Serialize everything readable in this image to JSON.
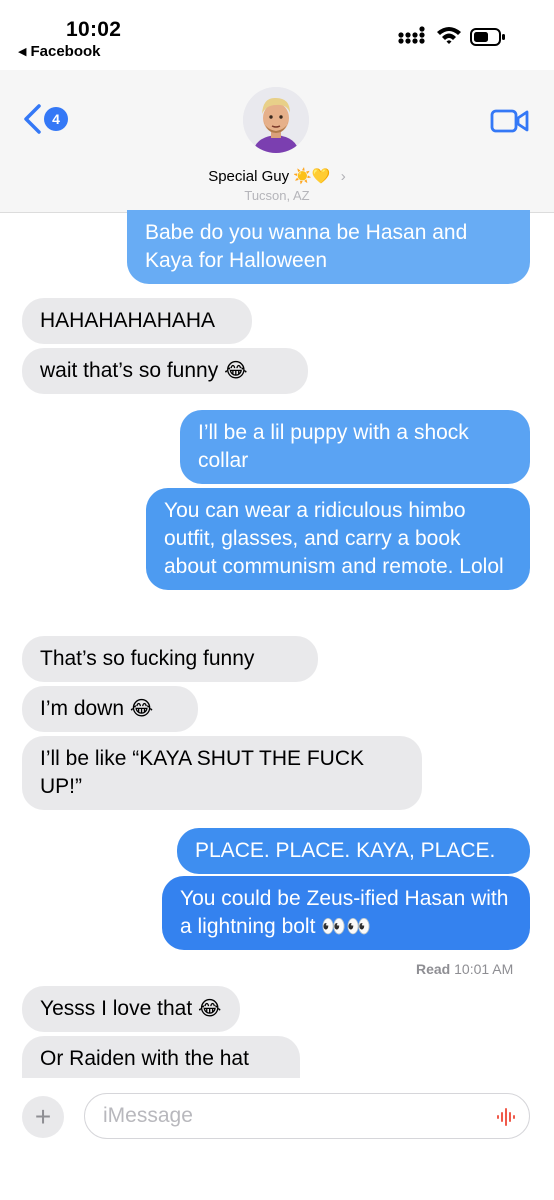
{
  "status": {
    "time": "10:02",
    "back_app": "Facebook"
  },
  "header": {
    "badge_count": "4",
    "contact_name": "Special Guy",
    "contact_emojis": "☀️💛",
    "contact_location": "Tucson, AZ"
  },
  "messages": [
    {
      "dir": "out",
      "text": "Babe do you wanna be Hasan and Kaya for Halloween"
    },
    {
      "dir": "in",
      "text": "HAHAHAHAHAHA"
    },
    {
      "dir": "in",
      "text": "wait that’s so funny",
      "emoji": "😂"
    },
    {
      "dir": "out",
      "text": "I’ll be a lil puppy with a shock collar"
    },
    {
      "dir": "out",
      "text": "You can wear a ridiculous himbo outfit, glasses, and carry a book about communism and remote. Lolol"
    },
    {
      "dir": "in",
      "text": "That’s so fucking funny"
    },
    {
      "dir": "in",
      "text": "I’m down",
      "emoji": "😂"
    },
    {
      "dir": "in",
      "text": "I’ll be like “KAYA SHUT THE FUCK UP!”"
    },
    {
      "dir": "out",
      "text": "PLACE. PLACE. KAYA, PLACE."
    },
    {
      "dir": "out",
      "text": "You could be Zeus-ified Hasan with a lightning bolt",
      "emoji": "👀👀"
    },
    {
      "dir": "in",
      "text": "Yesss I love that",
      "emoji": "😂"
    },
    {
      "dir": "in",
      "text": "Or Raiden with the hat"
    }
  ],
  "read_receipt": {
    "label": "Read",
    "time": "10:01 AM"
  },
  "input": {
    "placeholder": "iMessage"
  },
  "colors": {
    "accent": "#3478f6",
    "incoming_bubble": "#e9e9eb"
  }
}
